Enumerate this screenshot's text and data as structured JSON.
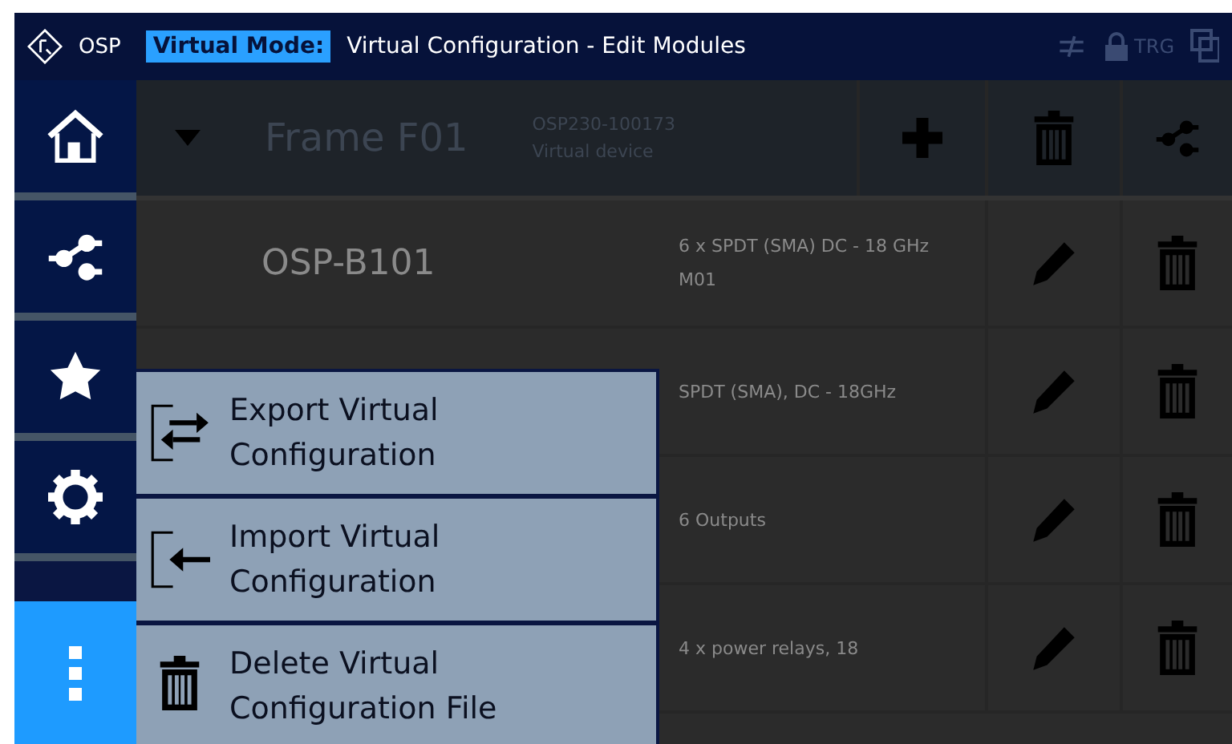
{
  "title_bar": {
    "brand": "OSP",
    "mode_badge": "Virtual Mode:",
    "title": "Virtual Configuration - Edit Modules",
    "trigger_label": "TRG"
  },
  "sidebar": {
    "items": [
      {
        "kind": "home",
        "selected": false
      },
      {
        "kind": "connections",
        "selected": false
      },
      {
        "kind": "favorites",
        "selected": false
      },
      {
        "kind": "settings",
        "selected": false
      },
      {
        "kind": "more",
        "selected": true
      }
    ]
  },
  "frame": {
    "name": "Frame F01",
    "serial": "OSP230-100173",
    "description": "Virtual device"
  },
  "modules": [
    {
      "name": "OSP-B101",
      "description": "6 x SPDT (SMA) DC - 18 GHz",
      "slot": "M01"
    },
    {
      "description": "SPDT (SMA), DC - 18GHz"
    },
    {
      "description": "6 Outputs"
    },
    {
      "description": "4 x power relays, 18"
    }
  ],
  "menu": {
    "items": [
      {
        "kind": "export",
        "label": "Export Virtual Configuration"
      },
      {
        "kind": "import",
        "label": "Import Virtual Configuration"
      },
      {
        "kind": "delete",
        "label": "Delete Virtual Configuration File"
      }
    ]
  }
}
